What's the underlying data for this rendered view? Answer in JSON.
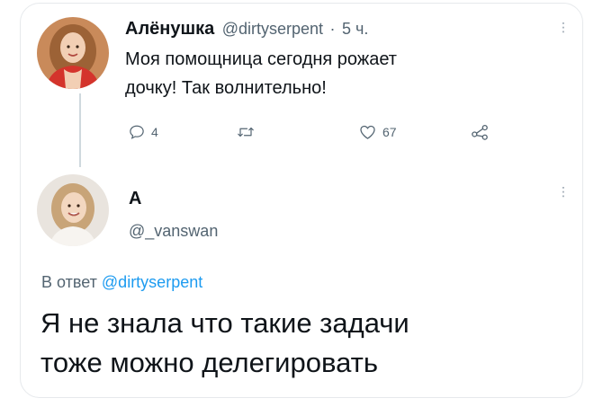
{
  "tweet": {
    "author_name": "Алёнушка",
    "author_handle": "@dirtyserpent",
    "separator": "·",
    "time": "5 ч.",
    "text_line1": "Моя помощница сегодня рожает",
    "text_line2": "дочку! Так волнительно!",
    "actions": {
      "reply_count": "4",
      "retweet_count": "",
      "like_count": "67"
    },
    "avatar_icon": "woman-avatar",
    "more_icon": "vertical-dots-icon"
  },
  "reply": {
    "author_name": "А",
    "author_handle": "@_vanswan",
    "reply_to_prefix": "В ответ",
    "reply_to_handle": "@dirtyserpent",
    "text_line1": "Я не знала что такие задачи",
    "text_line2": "тоже можно делегировать",
    "avatar_icon": "woman-avatar",
    "more_icon": "vertical-dots-icon"
  },
  "colors": {
    "accent": "#1d9bf0",
    "muted": "#536471",
    "text": "#0f1419",
    "border": "#e6e9ec"
  }
}
